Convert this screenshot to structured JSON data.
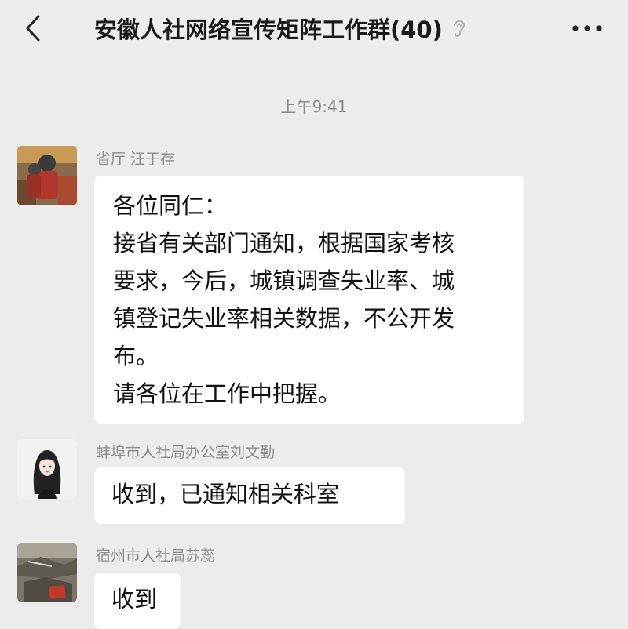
{
  "header": {
    "title": "安徽人社网络宣传矩阵工作群(40)",
    "back_icon": "chevron-left-icon",
    "mute_icon": "ear-icon",
    "more_icon": "more-dots-icon"
  },
  "timestamp": "上午9:41",
  "messages": [
    {
      "sender": "省厅 汪于存",
      "lines": [
        "各位同仁：",
        "接省有关部门通知，根据国家考核",
        "要求，今后，城镇调查失业率、城",
        "镇登记失业率相关数据，不公开发",
        "布。",
        "请各位在工作中把握。"
      ]
    },
    {
      "sender": "蚌埠市人社局办公室刘文勤",
      "lines": [
        "收到，已通知相关科室"
      ]
    },
    {
      "sender": "宿州市人社局苏蕊",
      "lines": [
        "收到"
      ]
    }
  ]
}
